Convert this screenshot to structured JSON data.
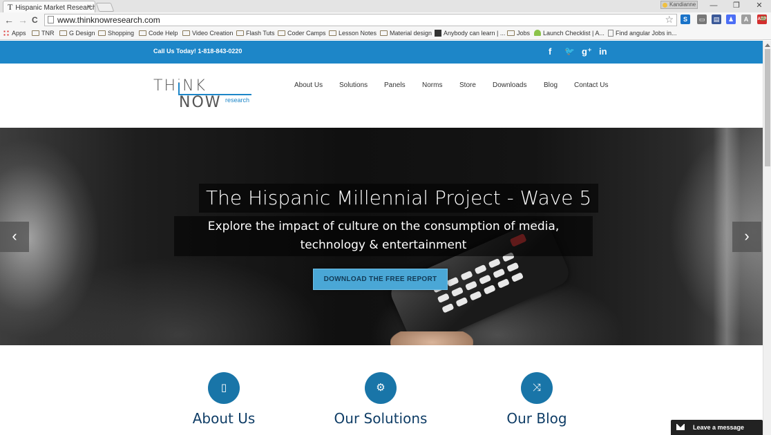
{
  "browser": {
    "tab_title": "Hispanic Market Research",
    "tab_close": "×",
    "profile_name": "Kandianne",
    "window_controls": {
      "minimize": "—",
      "restore": "❐",
      "close": "✕"
    },
    "url": "www.thinknowresearch.com",
    "nav": {
      "back": "←",
      "forward": "→",
      "reload": "C",
      "star": "☆"
    },
    "extensions": [
      {
        "icon": "s-extension-icon",
        "color": "#1a73c8",
        "text": "S"
      },
      {
        "icon": "cast-icon",
        "color": "#777777",
        "text": "▭"
      },
      {
        "icon": "clipboard-extension-icon",
        "color": "#3b5998",
        "text": "▤"
      },
      {
        "icon": "people-extension-icon",
        "color": "#4c6ef5",
        "text": "♟"
      },
      {
        "icon": "angular-extension-icon",
        "color": "#9e9e9e",
        "text": "A"
      },
      {
        "icon": "adblock-icon",
        "color": "#d32f2f",
        "text": "ABP"
      },
      {
        "icon": "menu-icon",
        "color": "#4caf50",
        "text": "≡"
      }
    ]
  },
  "bookmarks": [
    {
      "label": "Apps",
      "icon": "apps-icon"
    },
    {
      "label": "TNR",
      "icon": "folder-icon"
    },
    {
      "label": "G Design",
      "icon": "folder-icon"
    },
    {
      "label": "Shopping",
      "icon": "folder-icon"
    },
    {
      "label": "Code Help",
      "icon": "folder-icon"
    },
    {
      "label": "Video Creation",
      "icon": "folder-icon"
    },
    {
      "label": "Flash Tuts",
      "icon": "folder-icon"
    },
    {
      "label": "Coder Camps",
      "icon": "folder-icon"
    },
    {
      "label": "Lesson Notes",
      "icon": "folder-icon"
    },
    {
      "label": "Material design",
      "icon": "folder-icon"
    },
    {
      "label": "Anybody can learn | ...",
      "icon": "codeorg-icon"
    },
    {
      "label": "Jobs",
      "icon": "folder-icon"
    },
    {
      "label": "Launch Checklist | A...",
      "icon": "android-icon"
    },
    {
      "label": "Find angular Jobs in...",
      "icon": "page-icon"
    }
  ],
  "site": {
    "topbar": {
      "call": "Call Us Today! 1-818-843-0220",
      "social": [
        {
          "name": "facebook-icon",
          "glyph": "f"
        },
        {
          "name": "twitter-icon",
          "glyph": "🐦"
        },
        {
          "name": "googleplus-icon",
          "glyph": "g⁺"
        },
        {
          "name": "linkedin-icon",
          "glyph": "in"
        }
      ]
    },
    "logo": {
      "think": "THiNK",
      "now": "NOW",
      "research": "research"
    },
    "nav": [
      "About Us",
      "Solutions",
      "Panels",
      "Norms",
      "Store",
      "Downloads",
      "Blog",
      "Contact Us"
    ],
    "hero": {
      "title": "The Hispanic Millennial Project - Wave 5",
      "subtitle": "Explore the impact of culture on the consumption of media, technology & entertainment",
      "cta": "DOWNLOAD THE FREE REPORT",
      "prev": "‹",
      "next": "›"
    },
    "features": [
      {
        "label": "About Us",
        "icon": "tablet-icon",
        "glyph": "▯"
      },
      {
        "label": "Our Solutions",
        "icon": "gears-icon",
        "glyph": "⚙"
      },
      {
        "label": "Our Blog",
        "icon": "shuffle-icon",
        "glyph": "⤨"
      }
    ],
    "chat": "Leave a message"
  }
}
